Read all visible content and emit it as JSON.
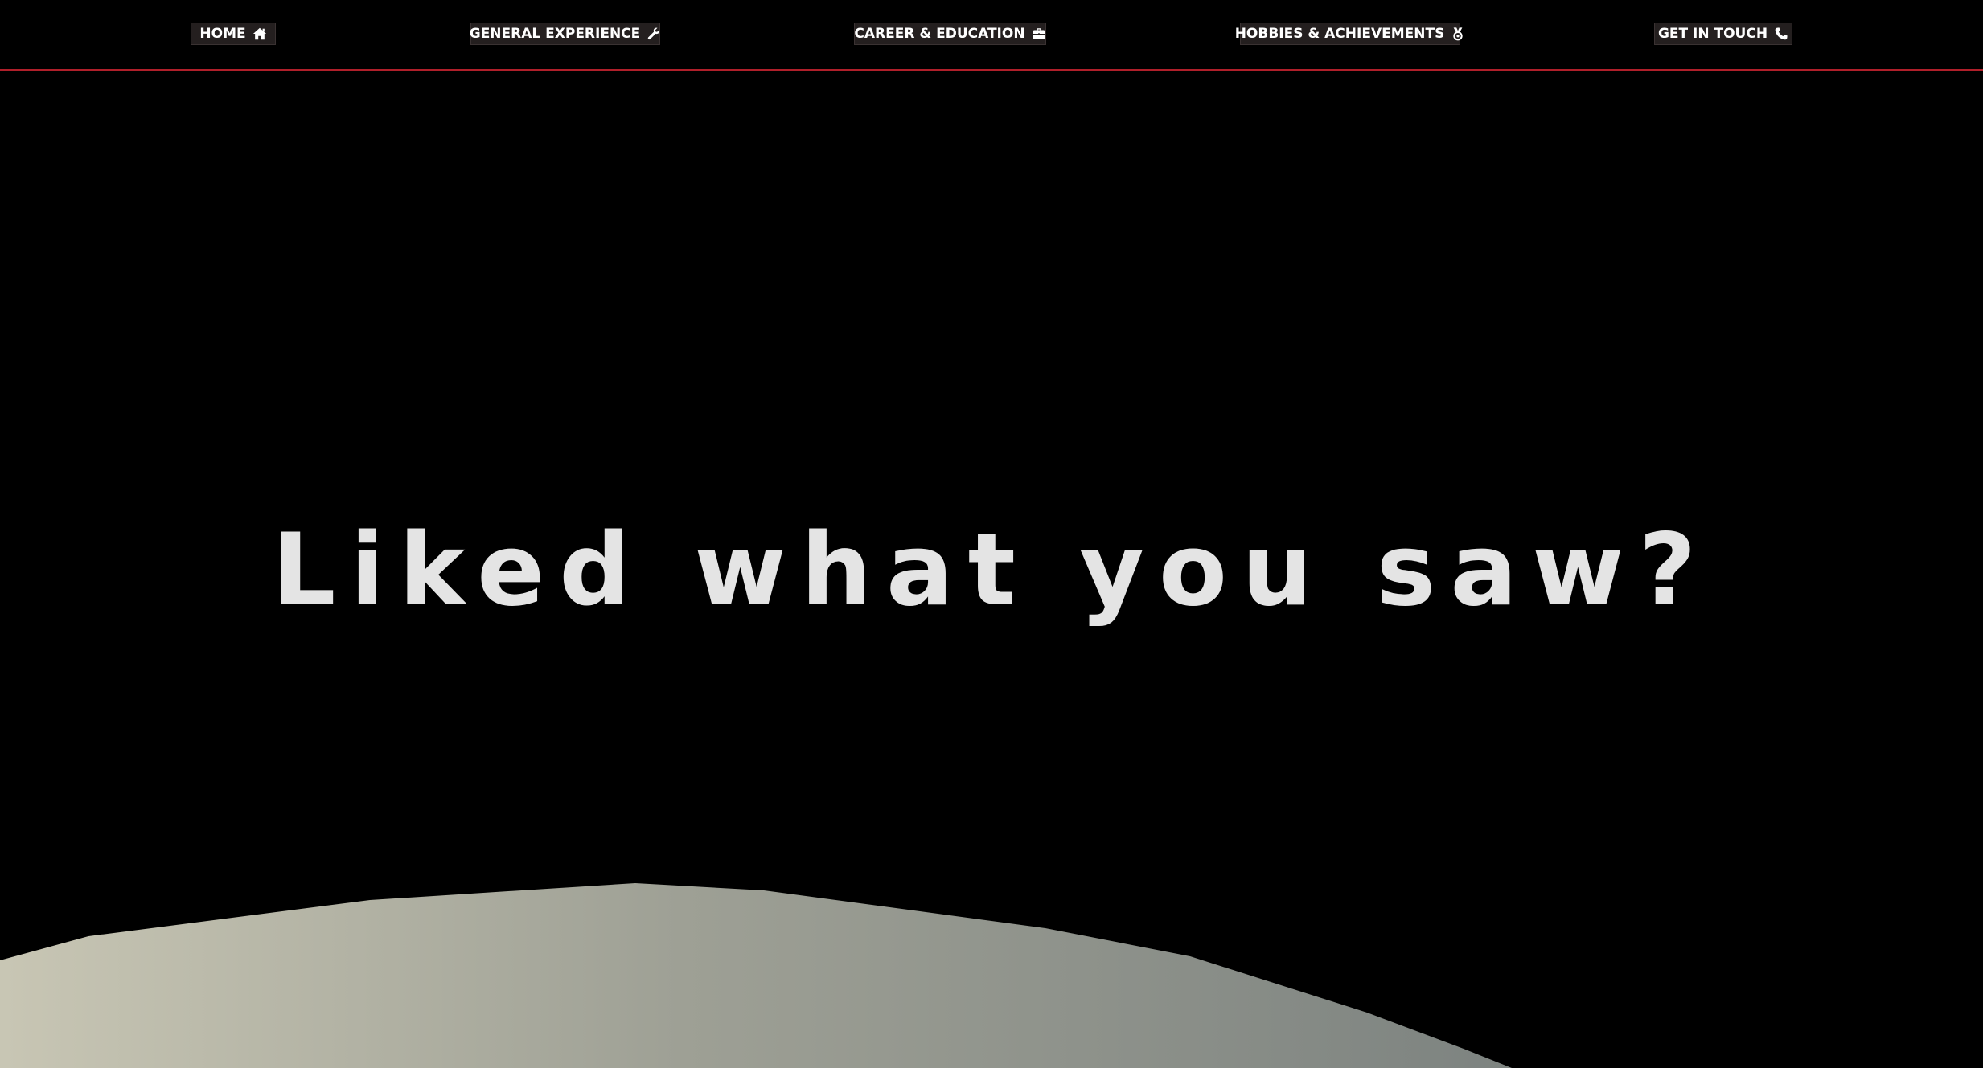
{
  "navbar": {
    "items": [
      {
        "label": "HOME",
        "icon": "home-icon"
      },
      {
        "label": "GENERAL EXPERIENCE",
        "icon": "wrench-icon"
      },
      {
        "label": "CAREER & EDUCATION",
        "icon": "briefcase-icon"
      },
      {
        "label": "HOBBIES & ACHIEVEMENTS",
        "icon": "medal-icon"
      },
      {
        "label": "GET IN TOUCH",
        "icon": "phone-icon"
      }
    ],
    "accent_line_color": "#b01f2a",
    "button_bg": "#241f1f"
  },
  "hero": {
    "heading": "Liked what you saw?",
    "text_color": "#e4e4e4",
    "background": "#000000"
  },
  "moon_surface": {
    "gradient_colors": [
      "#c8c6b4",
      "#9ea095",
      "#7d8380"
    ]
  }
}
